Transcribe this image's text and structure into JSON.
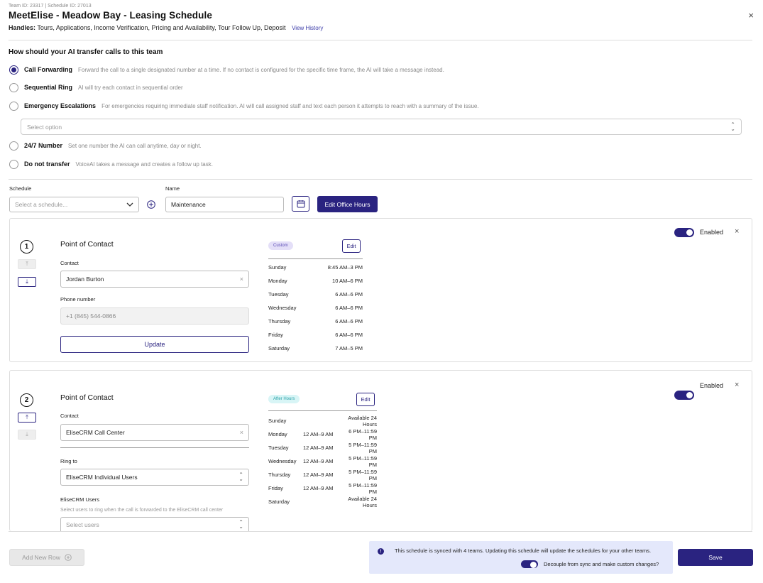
{
  "header": {
    "meta": "Team ID: 23317 | Schedule ID: 27013",
    "title": "MeetElise - Meadow Bay - Leasing Schedule",
    "handles_label": "Handles:",
    "handles_value": "Tours, Applications, Income Verification, Pricing and Availability, Tour Follow Up, Deposit",
    "view_history": "View History",
    "close": "×"
  },
  "transfer": {
    "question": "How should your AI transfer calls to this team",
    "options": [
      {
        "label": "Call Forwarding",
        "desc": "Forward the call to a single designated number at a time. If no contact is configured for the specific time frame, the AI will take a message instead.",
        "selected": true
      },
      {
        "label": "Sequential Ring",
        "desc": "AI will try each contact in sequential order",
        "selected": false
      },
      {
        "label": "Emergency Escalations",
        "desc": "For emergencies requiring immediate staff notification. AI will call assigned staff and text each person it attempts to reach with a summary of the issue.",
        "selected": false
      },
      {
        "label": "24/7 Number",
        "desc": "Set one number the AI can call anytime, day or night.",
        "selected": false
      },
      {
        "label": "Do not transfer",
        "desc": "VoiceAI takes a message and creates a follow up task.",
        "selected": false
      }
    ],
    "escalation_select_placeholder": "Select option"
  },
  "schedule": {
    "schedule_label": "Schedule",
    "schedule_placeholder": "Select a schedule...",
    "name_label": "Name",
    "name_value": "Maintenance",
    "edit_office_hours": "Edit Office Hours"
  },
  "contacts": [
    {
      "number": "1",
      "title": "Point of Contact",
      "contact_label": "Contact",
      "contact_value": "Jordan Burton",
      "phone_label": "Phone number",
      "phone_placeholder": "+1 (845) 544-0866",
      "update_label": "Update",
      "badge": "Custom",
      "edit_label": "Edit",
      "enabled_label": "Enabled",
      "hours": [
        {
          "day": "Sunday",
          "time": "8:45 AM–3 PM"
        },
        {
          "day": "Monday",
          "time": "10 AM–6 PM"
        },
        {
          "day": "Tuesday",
          "time": "6 AM–6 PM"
        },
        {
          "day": "Wednesday",
          "time": "6 AM–6 PM"
        },
        {
          "day": "Thursday",
          "time": "6 AM–6 PM"
        },
        {
          "day": "Friday",
          "time": "6 AM–6 PM"
        },
        {
          "day": "Saturday",
          "time": "7 AM–5 PM"
        }
      ]
    },
    {
      "number": "2",
      "title": "Point of Contact",
      "contact_label": "Contact",
      "contact_value": "EliseCRM Call Center",
      "ring_to_label": "Ring to",
      "ring_to_value": "EliseCRM Individual Users",
      "users_label": "EliseCRM Users",
      "users_help": "Select users to ring when the call is forwarded to the EliseCRM call center",
      "users_placeholder": "Select users",
      "badge": "After Hours",
      "edit_label": "Edit",
      "enabled_label": "Enabled",
      "hours": [
        {
          "day": "Sunday",
          "a": "",
          "b": "Available 24 Hours"
        },
        {
          "day": "Monday",
          "a": "12 AM–9 AM",
          "b": "6 PM–11:59 PM"
        },
        {
          "day": "Tuesday",
          "a": "12 AM–9 AM",
          "b": "5 PM–11:59 PM"
        },
        {
          "day": "Wednesday",
          "a": "12 AM–9 AM",
          "b": "5 PM–11:59 PM"
        },
        {
          "day": "Thursday",
          "a": "12 AM–9 AM",
          "b": "5 PM–11:59 PM"
        },
        {
          "day": "Friday",
          "a": "12 AM–9 AM",
          "b": "5 PM–11:59 PM"
        },
        {
          "day": "Saturday",
          "a": "",
          "b": "Available 24 Hours"
        }
      ]
    }
  ],
  "footer": {
    "add_row": "Add New Row",
    "sync_message": "This schedule is synced with 4 teams. Updating this schedule will update the schedules for your other teams.",
    "decouple_label": "Decouple from sync and make custom changes?",
    "save": "Save"
  },
  "colors": {
    "accent": "#2a2380",
    "custom_badge": "#e4dff8",
    "after_hours_badge": "#d8f5f6",
    "sync_bg": "#e4e8fb"
  }
}
